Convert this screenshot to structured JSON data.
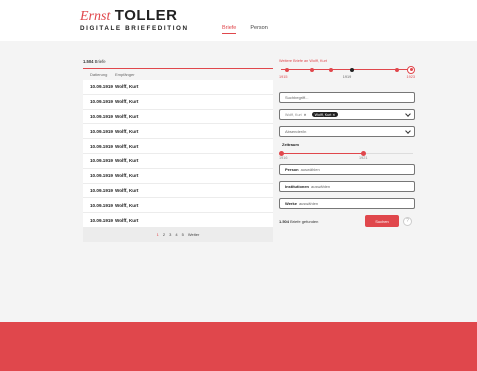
{
  "logo": {
    "ernst": "Ernst",
    "toller": "TOLLER",
    "subtitle": "DIGITALE BRIEFEDITION"
  },
  "nav": [
    {
      "label": "Briefe",
      "active": true
    },
    {
      "label": "Person",
      "active": false
    }
  ],
  "results": {
    "count_number": "1.504",
    "count_label": "Briefe",
    "headers": {
      "date": "Datierung",
      "recipient": "Empfänger"
    },
    "rows": [
      {
        "date": "10.09.1919",
        "name": "Wolff, Kurt"
      },
      {
        "date": "10.09.1919",
        "name": "Wolff, Kurt"
      },
      {
        "date": "10.09.1919",
        "name": "Wolff, Kurt"
      },
      {
        "date": "10.09.1919",
        "name": "Wolff, Kurt"
      },
      {
        "date": "10.09.1919",
        "name": "Wolff, Kurt"
      },
      {
        "date": "10.09.1919",
        "name": "Wolff, Kurt"
      },
      {
        "date": "10.09.1919",
        "name": "Wolff, Kurt"
      },
      {
        "date": "10.09.1919",
        "name": "Wolff, Kurt"
      },
      {
        "date": "10.09.1919",
        "name": "Wolff, Kurt"
      },
      {
        "date": "10.09.1919",
        "name": "Wolff, Kurt"
      }
    ],
    "pager": {
      "pages": [
        "1",
        "2",
        "3",
        "4",
        "5"
      ],
      "current": "1",
      "next": "Weiter"
    }
  },
  "filters": {
    "timeline_caption": "Weitere Briefe an Wolff, Kurt",
    "timeline_years": {
      "start": "1915",
      "mid": "1919",
      "end": "1923"
    },
    "search_placeholder": "Suchbegriff...",
    "tag_person": "Wolff, Kurt",
    "tag_person_active": "Wolff, Kurt",
    "sender_label": "Absender/in",
    "zeitraum_label": "Zeitraum",
    "range_years": {
      "from": "1916",
      "to": "1921"
    },
    "person_label": "Person",
    "person_placeholder": "auswählen",
    "institution_label": "Institutionen",
    "institution_placeholder": "auswählen",
    "works_label": "Werke",
    "works_placeholder": "auswählen",
    "found_number": "1.504",
    "found_label": "Briefe gefunden",
    "search_button": "Suchen",
    "help": "?"
  },
  "colors": {
    "accent": "#e0474c",
    "band": "#f4f4f4"
  }
}
